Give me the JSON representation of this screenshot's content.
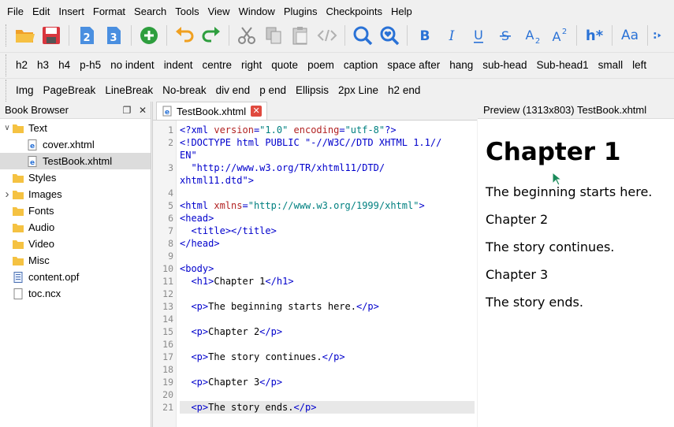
{
  "menu": [
    "File",
    "Edit",
    "Insert",
    "Format",
    "Search",
    "Tools",
    "View",
    "Window",
    "Plugins",
    "Checkpoints",
    "Help"
  ],
  "toolbar": {
    "heading_label": "h*",
    "case_label": "Aa"
  },
  "clips_row1": [
    "h2",
    "h3",
    "h4",
    "p-h5",
    "no indent",
    "indent",
    "centre",
    "right",
    "quote",
    "poem",
    "caption",
    "space after",
    "hang",
    "sub-head",
    "Sub-head1",
    "small",
    "left"
  ],
  "clips_row2": [
    "Img",
    "PageBreak",
    "LineBreak",
    "No-break",
    "div end",
    "p end",
    "Ellipsis",
    "2px Line",
    "h2 end"
  ],
  "book_browser": {
    "title": "Book Browser",
    "items": [
      {
        "label": "Text",
        "type": "folder",
        "expanded": true,
        "level": 0
      },
      {
        "label": "cover.xhtml",
        "type": "xhtml",
        "level": 1
      },
      {
        "label": "TestBook.xhtml",
        "type": "xhtml",
        "level": 1,
        "selected": true
      },
      {
        "label": "Styles",
        "type": "folder",
        "level": 0
      },
      {
        "label": "Images",
        "type": "folder",
        "level": 0,
        "collapsed": true
      },
      {
        "label": "Fonts",
        "type": "folder",
        "level": 0
      },
      {
        "label": "Audio",
        "type": "folder",
        "level": 0
      },
      {
        "label": "Video",
        "type": "folder",
        "level": 0
      },
      {
        "label": "Misc",
        "type": "folder",
        "level": 0
      },
      {
        "label": "content.opf",
        "type": "opf",
        "level": 0
      },
      {
        "label": "toc.ncx",
        "type": "ncx",
        "level": 0
      }
    ]
  },
  "editor": {
    "tab_label": "TestBook.xhtml",
    "lines": [
      {
        "n": "1",
        "code": "<?xml version=\"1.0\" encoding=\"utf-8\"?>"
      },
      {
        "n": "2",
        "code": "<!DOCTYPE html PUBLIC \"-//W3C//DTD XHTML 1.1//"
      },
      {
        "n": "",
        "code": "EN\""
      },
      {
        "n": "3",
        "code": "  \"http://www.w3.org/TR/xhtml11/DTD/"
      },
      {
        "n": "",
        "code": "xhtml11.dtd\">"
      },
      {
        "n": "4",
        "code": ""
      },
      {
        "n": "5",
        "code": "<html xmlns=\"http://www.w3.org/1999/xhtml\">"
      },
      {
        "n": "6",
        "code": "<head>"
      },
      {
        "n": "7",
        "code": "  <title></title>"
      },
      {
        "n": "8",
        "code": "</head>"
      },
      {
        "n": "9",
        "code": ""
      },
      {
        "n": "10",
        "code": "<body>"
      },
      {
        "n": "11",
        "code": "  <h1>Chapter 1</h1>"
      },
      {
        "n": "12",
        "code": ""
      },
      {
        "n": "13",
        "code": "  <p>The beginning starts here.</p>"
      },
      {
        "n": "14",
        "code": ""
      },
      {
        "n": "15",
        "code": "  <p>Chapter 2</p>"
      },
      {
        "n": "16",
        "code": ""
      },
      {
        "n": "17",
        "code": "  <p>The story continues.</p>"
      },
      {
        "n": "18",
        "code": ""
      },
      {
        "n": "19",
        "code": "  <p>Chapter 3</p>"
      },
      {
        "n": "20",
        "code": ""
      },
      {
        "n": "21",
        "code": "  <p>The story ends.</p>",
        "current": true
      }
    ]
  },
  "preview": {
    "title": "Preview (1313x803) TestBook.xhtml",
    "h1": "Chapter 1",
    "paragraphs": [
      "The beginning starts here.",
      "Chapter 2",
      "The story continues.",
      "Chapter 3",
      "The story ends."
    ]
  },
  "colors": {
    "tag": "#0000cc",
    "attr": "#b22222",
    "value": "#008080",
    "accent_blue": "#2a72d6",
    "green": "#2e9e3e",
    "folder": "#f5c242"
  }
}
